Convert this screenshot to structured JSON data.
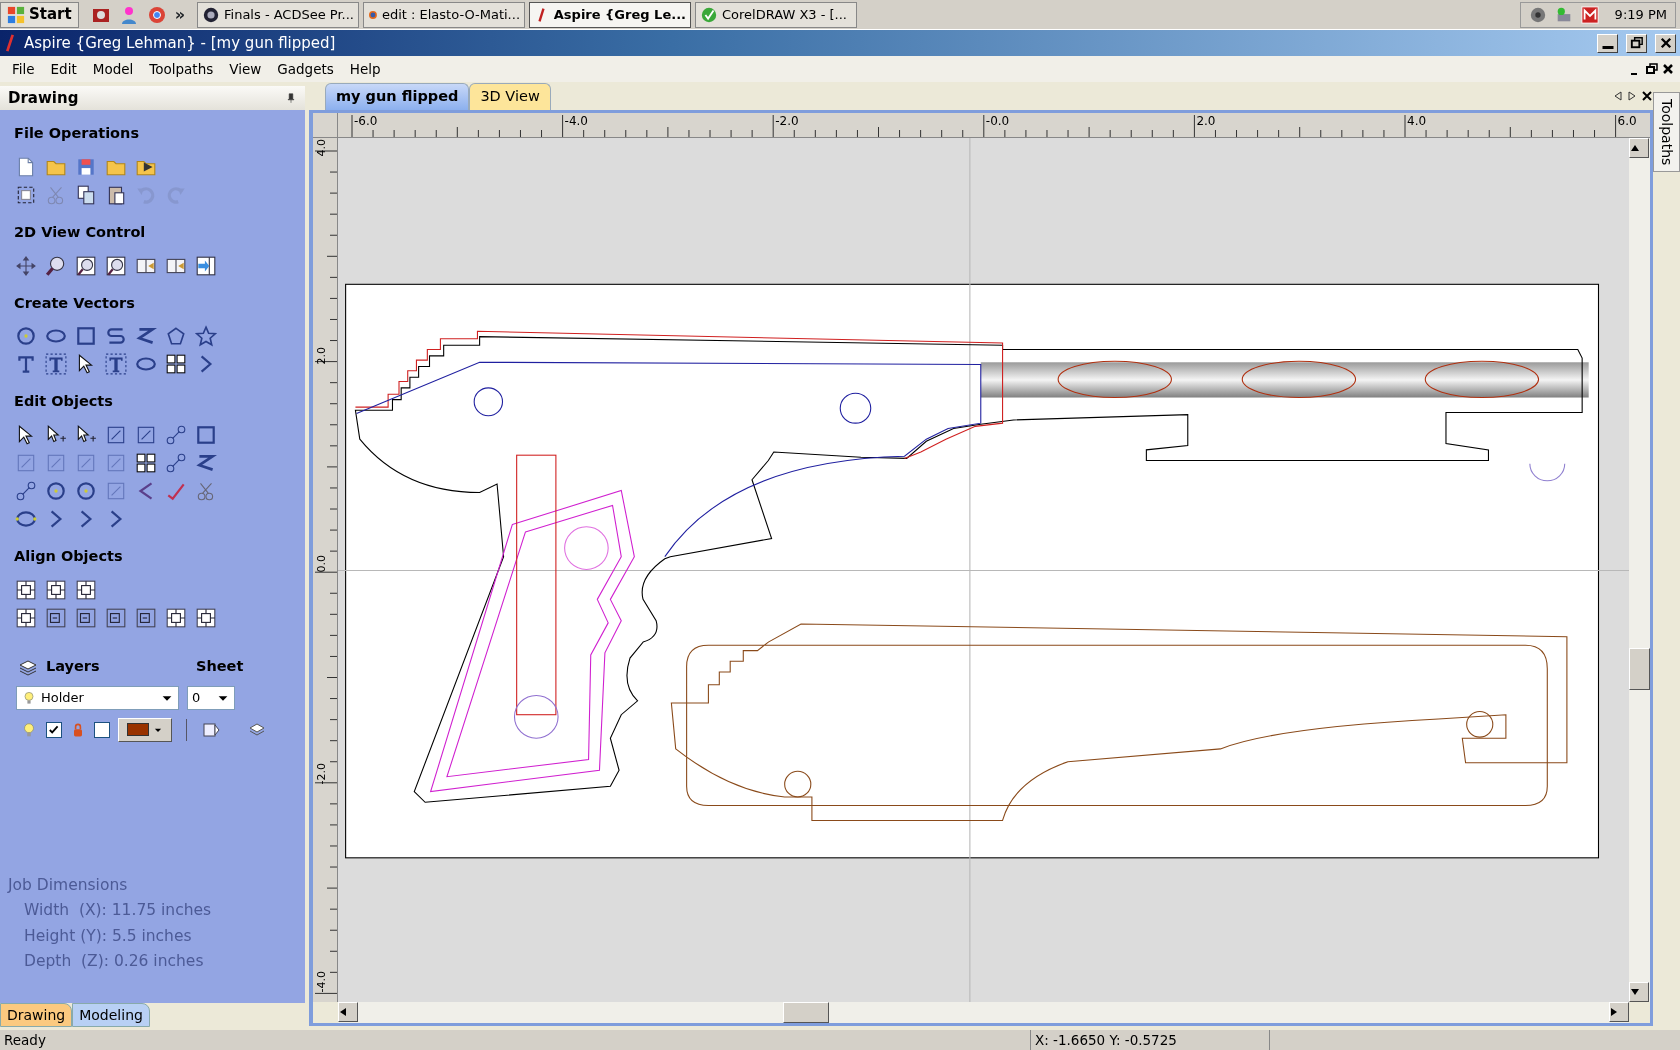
{
  "taskbar": {
    "start": "Start",
    "more": "»",
    "tasks": [
      {
        "label": "Finals - ACDSee Pr...",
        "selected": false
      },
      {
        "label": "edit : Elasto-O-Mati...",
        "selected": false
      },
      {
        "label": "Aspire {Greg Le...",
        "selected": true
      },
      {
        "label": "CorelDRAW X3 - [...",
        "selected": false
      }
    ],
    "clock": "9:19 PM"
  },
  "window": {
    "title": "Aspire {Greg Lehman} - [my gun flipped]"
  },
  "menu": [
    "File",
    "Edit",
    "Model",
    "Toolpaths",
    "View",
    "Gadgets",
    "Help"
  ],
  "panel": {
    "title": "Drawing",
    "sections": [
      {
        "heading": "File Operations"
      },
      {
        "heading": "2D View Control"
      },
      {
        "heading": "Create Vectors"
      },
      {
        "heading": "Edit Objects"
      },
      {
        "heading": "Align Objects"
      }
    ],
    "layers": {
      "label": "Layers",
      "layer": "Holder",
      "sheet_label": "Sheet",
      "sheet": "0",
      "visible": true,
      "locked": false,
      "color": "#993300"
    },
    "job_dimensions": {
      "title": "Job Dimensions",
      "lines": [
        "Width  (X): 11.75 inches",
        "Height (Y): 5.5 inches",
        "Depth  (Z): 0.26 inches"
      ]
    },
    "tabs": [
      {
        "label": "Drawing",
        "selected": true
      },
      {
        "label": "Modeling",
        "selected": false
      }
    ]
  },
  "document_tabs": [
    {
      "label": "my gun flipped",
      "selected": true
    },
    {
      "label": "3D View",
      "selected": false
    }
  ],
  "rulers": {
    "horizontal": [
      "-6.0",
      "-4.0",
      "-2.0",
      "-0.0",
      "2.0",
      "4.0",
      "6.0"
    ],
    "vertical": [
      "4.0",
      "2.0",
      "0.0",
      "-2.0",
      "-4.0"
    ]
  },
  "side_tabs": [
    "Toolpaths"
  ],
  "status_bar": {
    "message": "Ready",
    "coordinates": "X: -1.6650 Y: -0.5725"
  }
}
